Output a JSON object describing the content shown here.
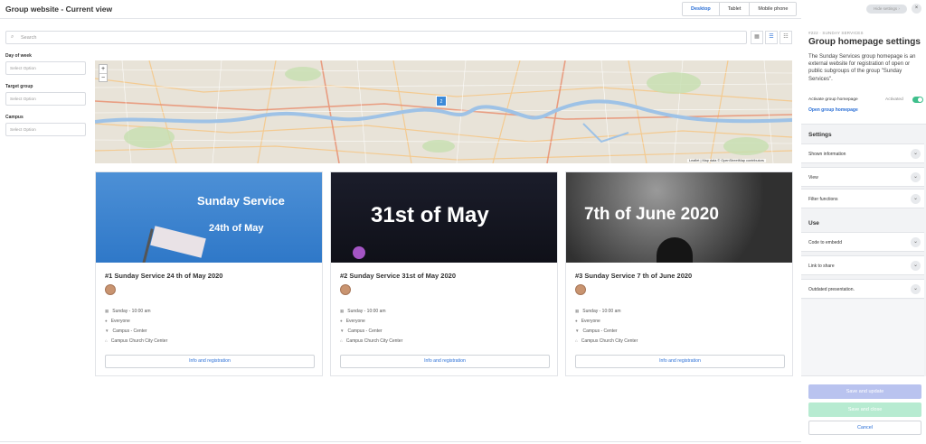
{
  "header": {
    "title": "Group website - Current view",
    "devices": [
      "Desktop",
      "Tablet",
      "Mobile phone"
    ],
    "active_device": "Desktop"
  },
  "search": {
    "placeholder": "Search",
    "icon": "search-icon"
  },
  "view_toggles": [
    "grid-icon",
    "list-icon",
    "table-icon"
  ],
  "filters": [
    {
      "label": "Day of week",
      "placeholder": "Select Option"
    },
    {
      "label": "Target group",
      "placeholder": "Select Option"
    },
    {
      "label": "Campus",
      "placeholder": "Select Option"
    }
  ],
  "map": {
    "zoom_in": "+",
    "zoom_out": "−",
    "marker_count": "2",
    "attribution": "Leaflet | Map data © OpenStreetMap contributors"
  },
  "cards": [
    {
      "image_line1": "Sunday Service",
      "image_line2": "24th of May",
      "title": "#1 Sunday Service 24 th of May 2020",
      "time": "Sunday - 10:00 am",
      "audience": "Everyone",
      "campus": "Campus - Center",
      "location": "Campus Church City Center",
      "button": "Info and registration"
    },
    {
      "image_line1": "31st of May",
      "title": "#2 Sunday Service 31st of May 2020",
      "time": "Sunday - 10:00 am",
      "audience": "Everyone",
      "campus": "Campus - Center",
      "location": "Campus Church City Center",
      "button": "Info and registration"
    },
    {
      "image_line1": "7th of June 2020",
      "title": "#3 Sunday Service 7 th of June 2020",
      "time": "Sunday - 10:00 am",
      "audience": "Everyone",
      "campus": "Campus - Center",
      "location": "Campus Church City Center",
      "button": "Info and registration"
    }
  ],
  "panel": {
    "hide_settings": "Hide settings",
    "close": "×",
    "subtitle": "#222 · SUNDAY SERVICES",
    "heading": "Group homepage settings",
    "description": "The Sunday Services group homepage is an external website for registration of open or public subgroups of the group \"Sunday Services\".",
    "activate_label": "Activate group homepage",
    "activate_status": "Activated",
    "open_link": "Open group homepage",
    "settings_heading": "Settings",
    "settings_items": [
      "Shown information",
      "View",
      "Filter functions"
    ],
    "use_heading": "Use",
    "use_items": [
      "Code to embedd",
      "Link to share",
      "Outdated presentation."
    ],
    "save_update": "Save and update",
    "save_close": "Save and close",
    "cancel": "Cancel"
  },
  "colors": {
    "accent": "#2a6fd6",
    "toggle": "#3fbf8c",
    "marker": "#3c8ad8"
  }
}
